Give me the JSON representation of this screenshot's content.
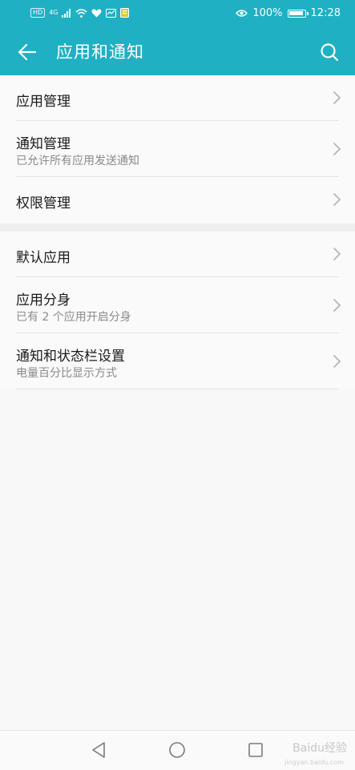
{
  "status_bar": {
    "network_chip": "HD",
    "signal_type": "4G",
    "battery_percent": "100%",
    "battery_level": 1.0,
    "time": "12:28",
    "icons": [
      "hd-icon",
      "signal-icon",
      "wifi-icon",
      "heart-icon",
      "activity-icon",
      "notification-icon",
      "eye-icon",
      "battery-icon"
    ]
  },
  "app_bar": {
    "title": "应用和通知",
    "back_icon": "back-arrow-icon",
    "search_icon": "search-icon"
  },
  "section1": {
    "items": [
      {
        "label": "应用管理",
        "subtitle": ""
      },
      {
        "label": "通知管理",
        "subtitle": "已允许所有应用发送通知"
      },
      {
        "label": "权限管理",
        "subtitle": ""
      }
    ]
  },
  "section2": {
    "items": [
      {
        "label": "默认应用",
        "subtitle": ""
      },
      {
        "label": "应用分身",
        "subtitle": "已有 2 个应用开启分身"
      },
      {
        "label": "通知和状态栏设置",
        "subtitle": "电量百分比显示方式"
      }
    ]
  },
  "nav_bar": {
    "buttons": [
      "nav-back-icon",
      "nav-home-icon",
      "nav-recent-icon"
    ]
  },
  "watermark": {
    "text": "Baidu经验",
    "sub": "jingyan.baidu.com"
  },
  "colors": {
    "accent": "#1fb0c4",
    "background": "#f8f8f8"
  }
}
